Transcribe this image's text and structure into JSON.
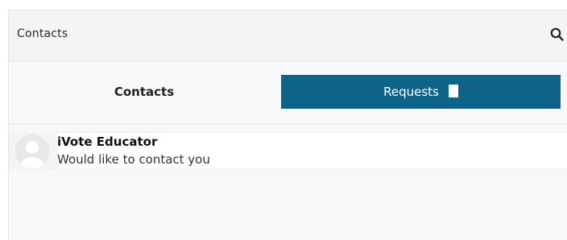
{
  "header": {
    "title": "Contacts",
    "search_icon": "search-icon"
  },
  "tabs": [
    {
      "label": "Contacts",
      "active": false
    },
    {
      "label": "Requests",
      "active": true
    }
  ],
  "requests": [
    {
      "name": "iVote Educator",
      "message": "Would like to contact you",
      "avatar_icon": "user-avatar-placeholder"
    }
  ],
  "colors": {
    "accent": "#0e6488",
    "panel_bg": "#f7f8fa",
    "header_bg": "#f4f4f4"
  }
}
